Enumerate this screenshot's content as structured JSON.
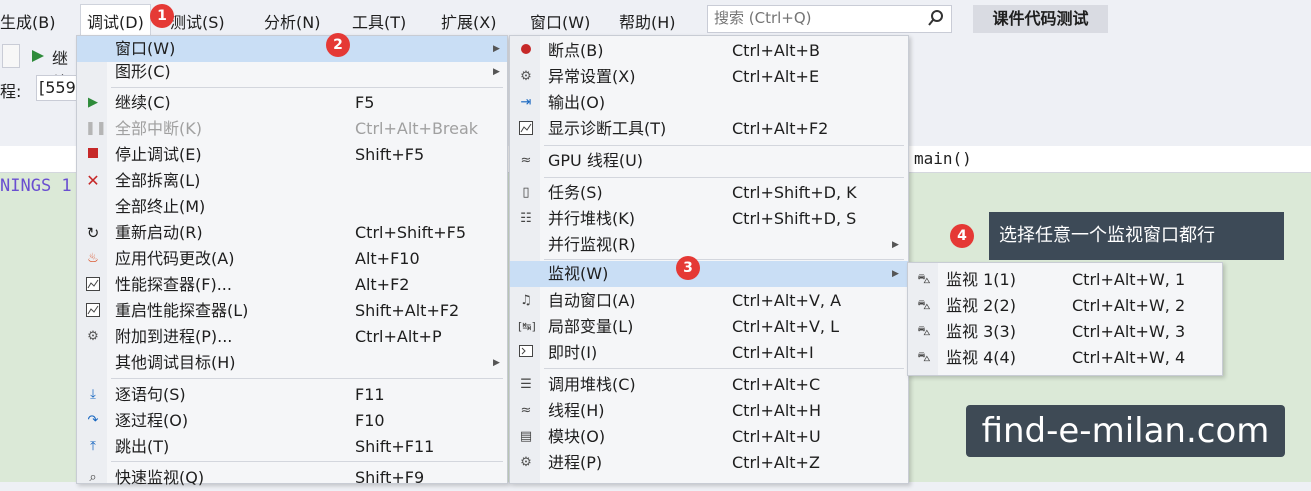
{
  "menubar": {
    "items": [
      "生成(B)",
      "调试(D)",
      "测试(S)",
      "分析(N)",
      "工具(T)",
      "扩展(X)",
      "窗口(W)",
      "帮助(H)"
    ],
    "search_placeholder": "搜索 (Ctrl+Q)",
    "course_button": "课件代码测试"
  },
  "toolbar": {
    "continue_label": "继续",
    "process_label": "程:",
    "process_value": "[559"
  },
  "code": {
    "warnings_text": "NINGS 1",
    "function_text": "main()"
  },
  "debug_menu": {
    "items": [
      {
        "label": "窗口(W)",
        "shortcut": "",
        "icon": "none"
      },
      {
        "label": "图形(C)",
        "shortcut": "",
        "icon": "none"
      },
      {
        "label": "继续(C)",
        "shortcut": "F5",
        "icon": "play-icon"
      },
      {
        "label": "全部中断(K)",
        "shortcut": "Ctrl+Alt+Break",
        "icon": "pause-icon"
      },
      {
        "label": "停止调试(E)",
        "shortcut": "Shift+F5",
        "icon": "stop-icon"
      },
      {
        "label": "全部拆离(L)",
        "shortcut": "",
        "icon": "close-icon"
      },
      {
        "label": "全部终止(M)",
        "shortcut": "",
        "icon": "none"
      },
      {
        "label": "重新启动(R)",
        "shortcut": "Ctrl+Shift+F5",
        "icon": "restart-icon"
      },
      {
        "label": "应用代码更改(A)",
        "shortcut": "Alt+F10",
        "icon": "hot-reload-icon"
      },
      {
        "label": "性能探查器(F)...",
        "shortcut": "Alt+F2",
        "icon": "profiler-icon"
      },
      {
        "label": "重启性能探查器(L)",
        "shortcut": "Shift+Alt+F2",
        "icon": "profiler-restart-icon"
      },
      {
        "label": "附加到进程(P)...",
        "shortcut": "Ctrl+Alt+P",
        "icon": "attach-icon"
      },
      {
        "label": "其他调试目标(H)",
        "shortcut": "",
        "icon": "none"
      },
      {
        "label": "逐语句(S)",
        "shortcut": "F11",
        "icon": "step-into-icon"
      },
      {
        "label": "逐过程(O)",
        "shortcut": "F10",
        "icon": "step-over-icon"
      },
      {
        "label": "跳出(T)",
        "shortcut": "Shift+F11",
        "icon": "step-out-icon"
      },
      {
        "label": "快速监视(Q)",
        "shortcut": "Shift+F9",
        "icon": "quick-watch-icon"
      }
    ]
  },
  "window_menu": {
    "items": [
      {
        "label": "断点(B)",
        "shortcut": "Ctrl+Alt+B",
        "icon": "breakpoint-icon"
      },
      {
        "label": "异常设置(X)",
        "shortcut": "Ctrl+Alt+E",
        "icon": "exception-icon"
      },
      {
        "label": "输出(O)",
        "shortcut": "",
        "icon": "output-icon"
      },
      {
        "label": "显示诊断工具(T)",
        "shortcut": "Ctrl+Alt+F2",
        "icon": "diagnostics-icon"
      },
      {
        "label": "GPU 线程(U)",
        "shortcut": "",
        "icon": "gpu-thread-icon"
      },
      {
        "label": "任务(S)",
        "shortcut": "Ctrl+Shift+D, K",
        "icon": "task-icon"
      },
      {
        "label": "并行堆栈(K)",
        "shortcut": "Ctrl+Shift+D, S",
        "icon": "parallel-stack-icon"
      },
      {
        "label": "并行监视(R)",
        "shortcut": "",
        "icon": "none"
      },
      {
        "label": "监视(W)",
        "shortcut": "",
        "icon": "none"
      },
      {
        "label": "自动窗口(A)",
        "shortcut": "Ctrl+Alt+V, A",
        "icon": "autos-icon"
      },
      {
        "label": "局部变量(L)",
        "shortcut": "Ctrl+Alt+V, L",
        "icon": "locals-icon"
      },
      {
        "label": "即时(I)",
        "shortcut": "Ctrl+Alt+I",
        "icon": "immediate-icon"
      },
      {
        "label": "调用堆栈(C)",
        "shortcut": "Ctrl+Alt+C",
        "icon": "call-stack-icon"
      },
      {
        "label": "线程(H)",
        "shortcut": "Ctrl+Alt+H",
        "icon": "threads-icon"
      },
      {
        "label": "模块(O)",
        "shortcut": "Ctrl+Alt+U",
        "icon": "modules-icon"
      },
      {
        "label": "进程(P)",
        "shortcut": "Ctrl+Alt+Z",
        "icon": "processes-icon"
      }
    ]
  },
  "watch_menu": {
    "items": [
      {
        "label": "监视 1(1)",
        "shortcut": "Ctrl+Alt+W, 1",
        "icon": "watch-icon"
      },
      {
        "label": "监视 2(2)",
        "shortcut": "Ctrl+Alt+W, 2",
        "icon": "watch-icon"
      },
      {
        "label": "监视 3(3)",
        "shortcut": "Ctrl+Alt+W, 3",
        "icon": "watch-icon"
      },
      {
        "label": "监视 4(4)",
        "shortcut": "Ctrl+Alt+W, 4",
        "icon": "watch-icon"
      }
    ]
  },
  "badges": [
    "1",
    "2",
    "3",
    "4"
  ],
  "tip_text": "选择任意一个监视窗口都行",
  "watermark": "find-e-milan.com",
  "colors": {
    "badge": "#e53935",
    "highlight": "#c9def5",
    "code_bg": "#dbe9d7",
    "tip_bg": "#3d4a57"
  }
}
